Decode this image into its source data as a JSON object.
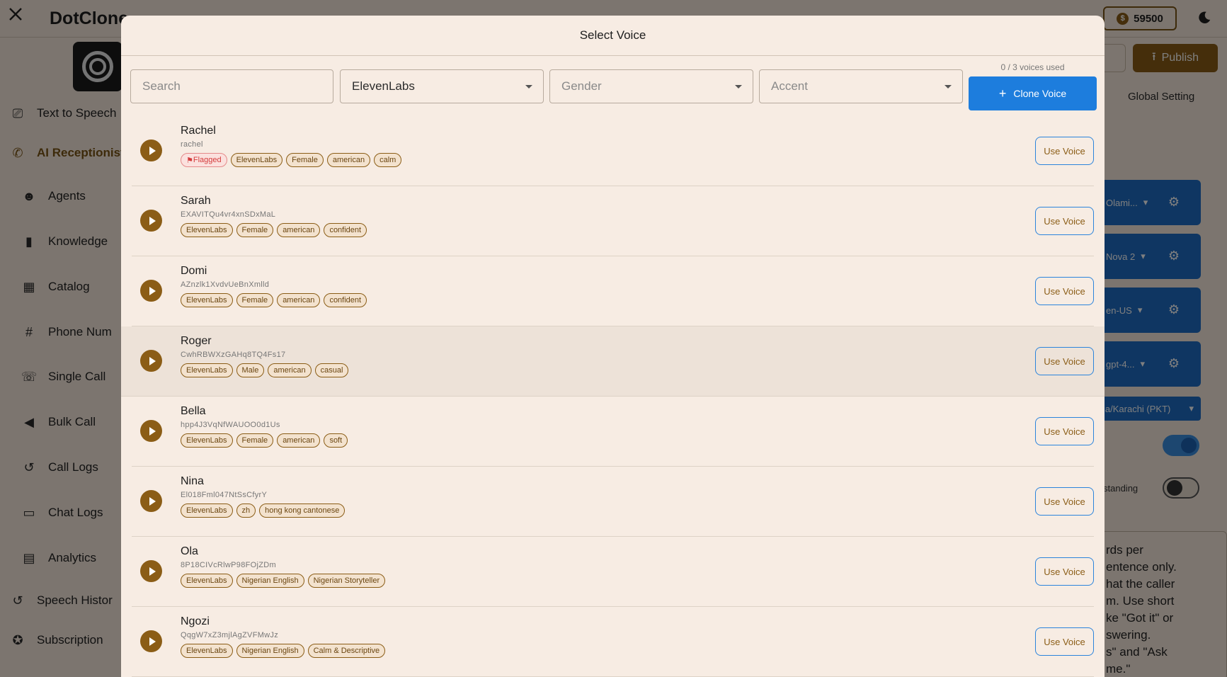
{
  "app": {
    "brand": "DotClone",
    "coins": "59500",
    "publish_label": "Publish",
    "global_setting_label": "Global Setting",
    "timezone_fragment": "ia/Karachi (PKT)",
    "understanding_fragment": "standing",
    "right_cards": [
      "Olami...",
      "Nova 2",
      "en-US",
      "gpt-4..."
    ],
    "prompt_fragment": "rds per\nentence only.\nhat the caller\nm. Use short\nke \"Got it\" or\nswering.\ns\" and \"Ask\nme.\""
  },
  "sidebar": {
    "items": [
      {
        "label": "Text to Speech",
        "icon": "tts-icon"
      },
      {
        "label": "AI Receptionist",
        "icon": "phone-icon"
      },
      {
        "label": "Agents",
        "icon": "robot-icon"
      },
      {
        "label": "Knowledge",
        "icon": "book-icon"
      },
      {
        "label": "Catalog",
        "icon": "grid-icon"
      },
      {
        "label": "Phone Num",
        "icon": "hash-icon"
      },
      {
        "label": "Single Call",
        "icon": "call-icon"
      },
      {
        "label": "Bulk Call",
        "icon": "megaphone-icon"
      },
      {
        "label": "Call Logs",
        "icon": "history-icon"
      },
      {
        "label": "Chat Logs",
        "icon": "chat-icon"
      },
      {
        "label": "Analytics",
        "icon": "chart-icon"
      },
      {
        "label": "Speech Histor",
        "icon": "history-icon"
      },
      {
        "label": "Subscription",
        "icon": "badge-icon"
      }
    ]
  },
  "modal": {
    "title": "Select Voice",
    "search_placeholder": "Search",
    "provider_value": "ElevenLabs",
    "gender_placeholder": "Gender",
    "accent_placeholder": "Accent",
    "usage": "0 / 3 voices used",
    "clone_label": "Clone Voice",
    "use_label": "Use Voice",
    "voices": [
      {
        "name": "Rachel",
        "id": "rachel",
        "flagged": "Flagged",
        "tags": [
          "ElevenLabs",
          "Female",
          "american",
          "calm"
        ]
      },
      {
        "name": "Sarah",
        "id": "EXAVITQu4vr4xnSDxMaL",
        "tags": [
          "ElevenLabs",
          "Female",
          "american",
          "confident"
        ]
      },
      {
        "name": "Domi",
        "id": "AZnzlk1XvdvUeBnXmlld",
        "tags": [
          "ElevenLabs",
          "Female",
          "american",
          "confident"
        ]
      },
      {
        "name": "Roger",
        "id": "CwhRBWXzGAHq8TQ4Fs17",
        "tags": [
          "ElevenLabs",
          "Male",
          "american",
          "casual"
        ]
      },
      {
        "name": "Bella",
        "id": "hpp4J3VqNfWAUOO0d1Us",
        "tags": [
          "ElevenLabs",
          "Female",
          "american",
          "soft"
        ]
      },
      {
        "name": "Nina",
        "id": "El018Fml047NtSsCfyrY",
        "tags": [
          "ElevenLabs",
          "zh",
          "hong kong cantonese"
        ]
      },
      {
        "name": "Ola",
        "id": "8P18CIVcRlwP98FOjZDm",
        "tags": [
          "ElevenLabs",
          "Nigerian English",
          "Nigerian Storyteller"
        ]
      },
      {
        "name": "Ngozi",
        "id": "QqgW7xZ3mjlAgZVFMwJz",
        "tags": [
          "ElevenLabs",
          "Nigerian English",
          "Calm & Descriptive"
        ]
      }
    ]
  }
}
